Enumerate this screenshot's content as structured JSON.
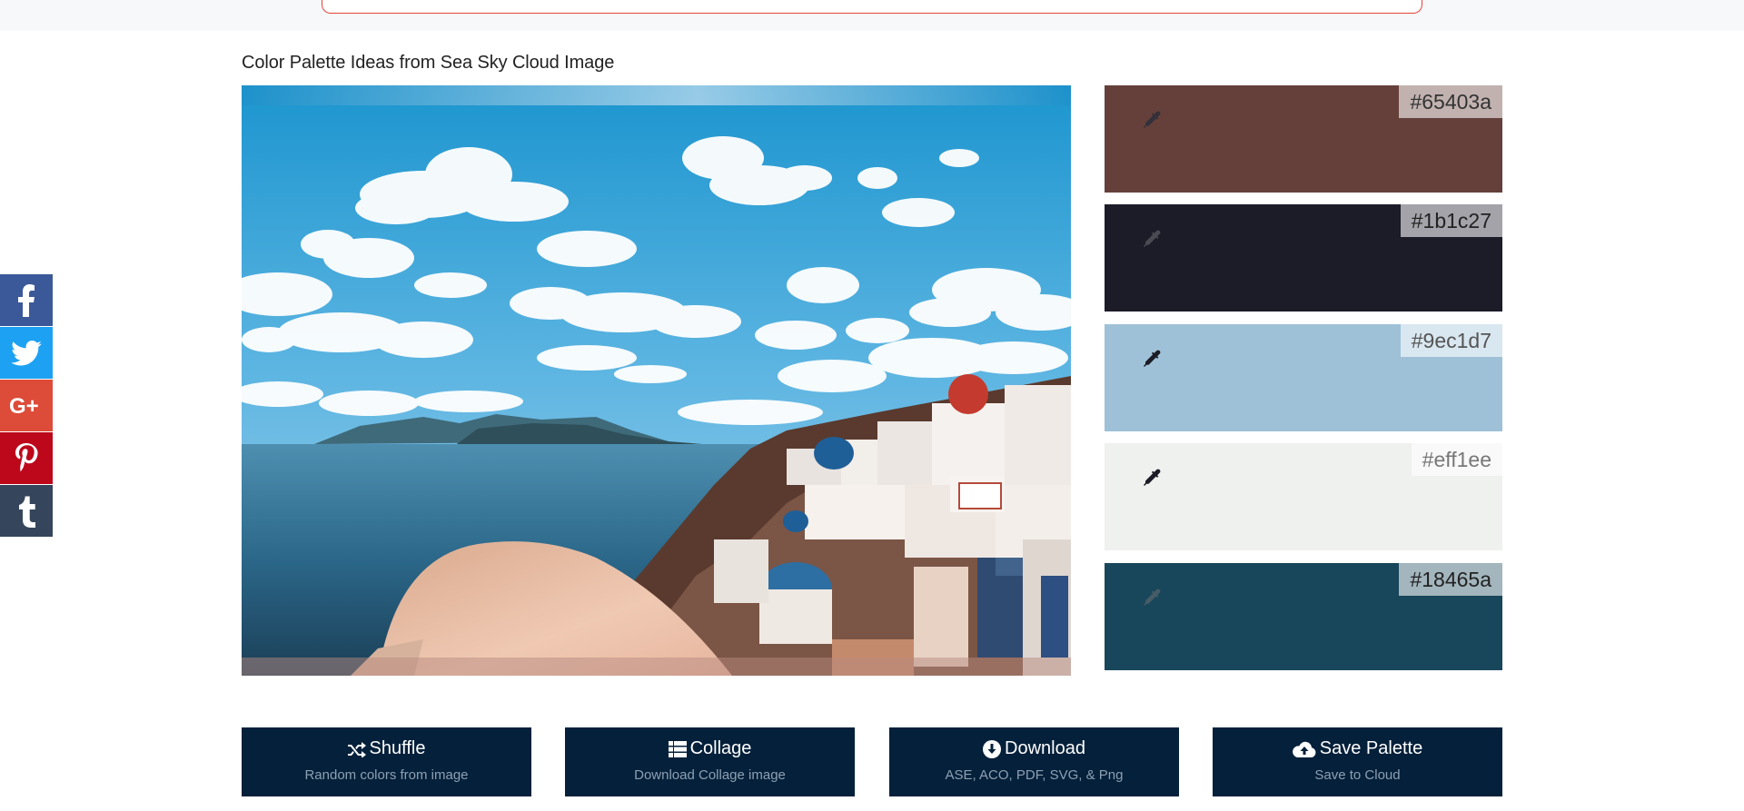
{
  "page": {
    "title": "Color Palette Ideas from Sea Sky Cloud Image"
  },
  "social": [
    {
      "name": "facebook",
      "glyph": "f",
      "color": "#3b5998"
    },
    {
      "name": "twitter",
      "glyph": "",
      "color": "#1da1f2"
    },
    {
      "name": "google-plus",
      "glyph": "G+",
      "color": "#dd4b39"
    },
    {
      "name": "pinterest",
      "glyph": "",
      "color": "#bd081c"
    },
    {
      "name": "tumblr",
      "glyph": "t",
      "color": "#35465c"
    }
  ],
  "palette": [
    {
      "hex": "#65403a",
      "label": "#65403a"
    },
    {
      "hex": "#1b1c27",
      "label": "#1b1c27"
    },
    {
      "hex": "#9ec1d7",
      "label": "#9ec1d7"
    },
    {
      "hex": "#eff1ee",
      "label": "#eff1ee"
    },
    {
      "hex": "#18465a",
      "label": "#18465a"
    }
  ],
  "actions": [
    {
      "label": "Shuffle",
      "sub": "Random colors from image",
      "icon": "shuffle-icon"
    },
    {
      "label": "Collage",
      "sub": "Download Collage image",
      "icon": "grid-list-icon"
    },
    {
      "label": "Download",
      "sub": "ASE, ACO, PDF, SVG, & Png",
      "icon": "download-circle-icon"
    },
    {
      "label": "Save Palette",
      "sub": "Save to Cloud",
      "icon": "cloud-upload-icon"
    }
  ],
  "colors": {
    "action_bg": "#04203a",
    "action_sub": "#8ea0b3",
    "top_border": "#e2433a"
  }
}
